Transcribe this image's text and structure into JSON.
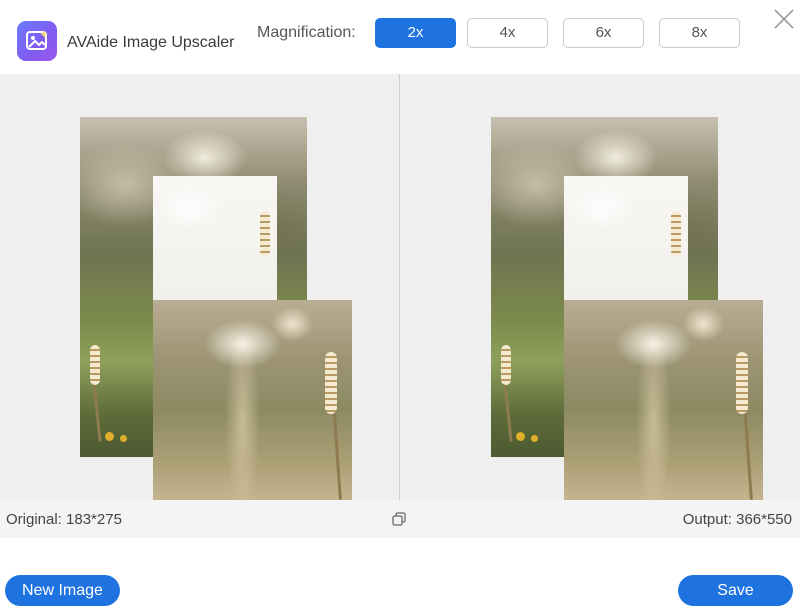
{
  "header": {
    "app_title": "AVAide Image Upscaler",
    "logo_icon": "image-sparkle-icon",
    "magnification_label": "Magnification:",
    "magnification_options": [
      "2x",
      "4x",
      "6x",
      "8x"
    ],
    "selected_magnification": "2x",
    "close_icon": "close-icon"
  },
  "info": {
    "original_label": "Original: 183*275",
    "output_label": "Output: 366*550",
    "compare_icon": "copy-compare-icon"
  },
  "footer": {
    "new_image_label": "New Image",
    "save_label": "Save"
  },
  "colors": {
    "accent": "#1f73e0",
    "preview_bg": "#efefef"
  }
}
